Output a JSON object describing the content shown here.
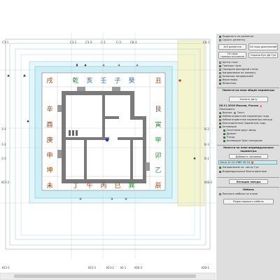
{
  "plan": {
    "corner_labels": {
      "top_left": "СЗ-1",
      "top_right": "СВ-1",
      "bottom_left": "ЮЗ-1",
      "bottom_right": "ЮВ-1"
    },
    "top_labels": [
      "С3-2",
      "С3-3",
      "С-1",
      "С-3",
      "СВ-3"
    ],
    "bottom_labels": [
      "Ю3-3",
      "Ю3-2",
      "Ю-1",
      "ЮВ-3"
    ],
    "left_labels": [
      "З-1",
      "З-2",
      "З-3",
      "ЮЗ-3"
    ],
    "right_labels": [
      "В-2",
      "В-3",
      "В-1",
      "ЮВ-2"
    ],
    "ring_left": [
      "戌",
      "辛",
      "酉",
      "庚",
      "申",
      "坤",
      "未"
    ],
    "ring_right": [
      "丑",
      "艮",
      "寅",
      "甲",
      "卯",
      "乙",
      "辰"
    ],
    "ring_top": [
      "乾",
      "亥",
      "壬",
      "子",
      "癸"
    ],
    "ring_bottom": [
      "丁",
      "午",
      "丙",
      "巳",
      "巽"
    ],
    "colors": {
      "outer_brown": "#8b4513",
      "green": "#2e8b3a",
      "blue": "#2b6cb0",
      "red": "#c0392b",
      "cyan_zone": "#bfeef6",
      "yellow_zone": "#f5f5c8",
      "wall": "#7a7a7a"
    }
  },
  "panel": {
    "opt_show_layout": "Подрезать на разметке",
    "opt_hide_layout": "Скрыть разметку",
    "btn_3x3": "3х3 разметка",
    "btn_24_diag": "24 горы диагоналей",
    "btn_24_straight": "24 горы прямоугольников",
    "btn_bagua": "Охрана Кун Да Гуа",
    "chk_center": "Центр горы",
    "chk_borders": "Границы горы",
    "chk_facade": "Середина фасадной стены",
    "chk_compass": "Направление по компасу",
    "chk_no_dirs": "Название направлений",
    "chk_icons": "Иероглифы",
    "chk_animals": "Животные",
    "section1_title": "Нанести на план общие параметры",
    "btn_date": "Указать дату",
    "date_text": "26.11.2016 Москва, Россия",
    "show_label": "Показывать",
    "radio_icons": "Иконки",
    "radio_text": "Текст",
    "chk_unfav_year": "Неблагоприятные параметры года",
    "chk_unfav_month": "Неблагоприятные параметры месяца",
    "chk_fav_year": "Благоприятные параметры года",
    "chk_activate": "Активация",
    "chk_stars": "Сочетание двух звезд",
    "chk_dragon": "Дракон",
    "chk_bird": "Птица",
    "chk_three": "Активация Трёх генералов",
    "section2_title": "Нанести на план индивидуальные параметры",
    "btn_add_person": "Добавить человека",
    "person_entry": "Анна 12.12.1985 09:16",
    "chk_direction": "Направление по -числу Гуа",
    "chk_indiv": "Индивидуальные благоприятные",
    "btn_flying_stars": "Летящие звезды",
    "furniture_title": "Мебель",
    "chk_show_furniture": "Показать мебель на плане",
    "btn_edit_furniture": "Редактировать мебель"
  }
}
